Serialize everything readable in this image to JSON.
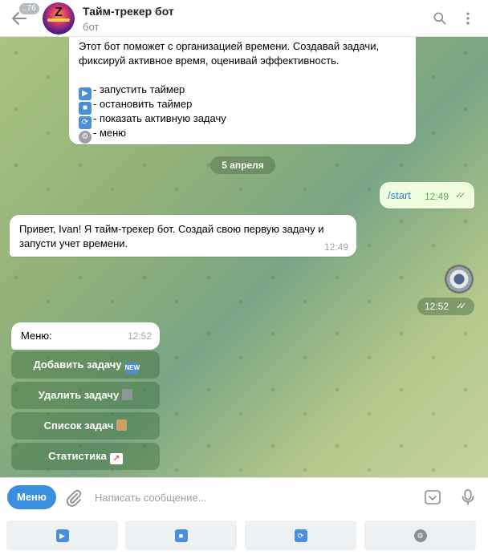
{
  "header": {
    "back_badge": "..76",
    "title": "Тайм-трекер бот",
    "subtitle": "бот"
  },
  "messages": {
    "intro": {
      "line1": "Этот бот поможет с организацией времени. Создавай задачи,",
      "line2": "фиксируй активное время, оценивай эффективность.",
      "cmd1": "- запустить таймер",
      "cmd2": "- остановить таймер",
      "cmd3": "- показать активную задачу",
      "cmd4": "- меню"
    },
    "date_separator": "5 апреля",
    "outgoing": {
      "text": "/start",
      "time": "12:49"
    },
    "greeting": {
      "text": "Привет, Ivan! Я тайм-трекер бот. Создай свою первую задачу и запусти учет времени.",
      "time": "12:49"
    },
    "sticker_time": "12:52",
    "menu": {
      "text": "Меню:",
      "time": "12:52"
    }
  },
  "inline_keyboard": [
    {
      "label": "Добавить задачу",
      "emoji": "new-badge"
    },
    {
      "label": "Удалить задачу",
      "emoji": "trash-can"
    },
    {
      "label": "Список задач",
      "emoji": "clipboard"
    },
    {
      "label": "Статистика",
      "emoji": "chart"
    }
  ],
  "composer": {
    "menu_label": "Меню",
    "placeholder": "Написать сообщение..."
  },
  "reply_keyboard": [
    "play",
    "stop",
    "repeat",
    "gear"
  ],
  "colors": {
    "accent": "#3a8fe0",
    "outgoing_bubble": "#effdde",
    "check": "#62a85c"
  }
}
